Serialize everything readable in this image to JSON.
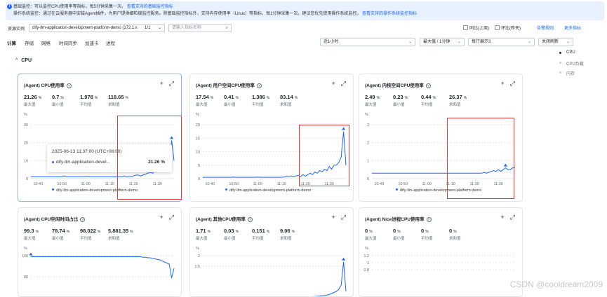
{
  "notice": {
    "line1_prefix": "基础监控：可以监控CPU使用率等指标，每5分钟采集一次。",
    "line1_link": "查看支持的基础监控指标",
    "line2_prefix": "操作系统监控：通过在云服务器中安装Agent插件，为用户提供细粒度监控服务。除基础监控指标外，支持内存使用率（Linux）等指标，每1分钟采集一次。建议您优先使用操作系统监控。",
    "line2_link": "查看支持的操作系统监控指标"
  },
  "filter": {
    "resource_label": "资源实例",
    "instance_value": "dify-llm-application-development-platform-demo (172.1...",
    "clear_icon": "×",
    "page_indicator": "1/1",
    "search_placeholder": "请输入指标名称",
    "compare_prev": "同比(上周)",
    "compare_yesterday": "环比(昨天)",
    "alarm_link": "告警规则",
    "more_link": "更多指标"
  },
  "tabs": [
    "计算",
    "存储",
    "网络",
    "时间同步",
    "加速卡",
    "进程"
  ],
  "controls": {
    "time_range": "近1小时",
    "aggregation": "最大值 / 1分钟",
    "layout": "每行展示3",
    "refresh": "关闭刷新"
  },
  "section": {
    "title": "CPU"
  },
  "sidenav": [
    "CPU",
    "CPU负载",
    "内存"
  ],
  "cards": [
    {
      "title": "(Agent) CPU使用率",
      "stats": [
        {
          "value": "21.26",
          "unit": "%",
          "name": "最大值"
        },
        {
          "value": "0.7",
          "unit": "%",
          "name": "最小值"
        },
        {
          "value": "1.978",
          "unit": "%",
          "name": "平均值"
        },
        {
          "value": "118.65",
          "unit": "%",
          "name": "求和值"
        }
      ],
      "unit": "%",
      "legend": "dify-llm-application-development-platform-demo"
    },
    {
      "title": "(Agent) 用户空间CPU使用率",
      "stats": [
        {
          "value": "17.54",
          "unit": "%",
          "name": "最大值"
        },
        {
          "value": "0.41",
          "unit": "%",
          "name": "最小值"
        },
        {
          "value": "1.386",
          "unit": "%",
          "name": "平均值"
        },
        {
          "value": "83.14",
          "unit": "%",
          "name": "求和值"
        }
      ],
      "unit": "%",
      "legend": "dify-llm-application-development-platform-demo"
    },
    {
      "title": "(Agent) 内核空间CPU使用率",
      "stats": [
        {
          "value": "2.49",
          "unit": "%",
          "name": "最大值"
        },
        {
          "value": "0.23",
          "unit": "%",
          "name": "最小值"
        },
        {
          "value": "0.44",
          "unit": "%",
          "name": "平均值"
        },
        {
          "value": "26.37",
          "unit": "%",
          "name": "求和值"
        }
      ],
      "unit": "%",
      "legend": "dify-llm-application-development-platform-demo"
    },
    {
      "title": "(Agent) CPU空闲时间占比",
      "stats": [
        {
          "value": "99.3",
          "unit": "%",
          "name": "最大值"
        },
        {
          "value": "78.74",
          "unit": "%",
          "name": "最小值"
        },
        {
          "value": "98.022",
          "unit": "%",
          "name": "平均值"
        },
        {
          "value": "5,881.35",
          "unit": "%",
          "name": "求和值"
        }
      ],
      "unit": "%",
      "legend": ""
    },
    {
      "title": "(Agent) 其他CPU使用率",
      "stats": [
        {
          "value": "1.71",
          "unit": "%",
          "name": "最大值"
        },
        {
          "value": "0.03",
          "unit": "%",
          "name": "最小值"
        },
        {
          "value": "0.151",
          "unit": "%",
          "name": "平均值"
        },
        {
          "value": "9.06",
          "unit": "%",
          "name": "求和值"
        }
      ],
      "unit": "%",
      "legend": ""
    },
    {
      "title": "(Agent) Nice进程CPU使用率",
      "stats": [
        {
          "value": "0",
          "unit": "%",
          "name": "最大值"
        },
        {
          "value": "0",
          "unit": "%",
          "name": "最小值"
        },
        {
          "value": "0",
          "unit": "%",
          "name": "平均值"
        },
        {
          "value": "0",
          "unit": "%",
          "name": "求和值"
        }
      ],
      "unit": "%",
      "legend": ""
    }
  ],
  "tooltip": {
    "time": "2025-06-13 11:37:00 (UTC+08:00)",
    "series": "dify-llm-application-devel...",
    "value": "21.26 %"
  },
  "watermark": "CSDN @cooldream2009",
  "chart_data": [
    {
      "type": "line",
      "x": [
        "10:37",
        "10:38",
        "10:39",
        "10:40",
        "10:41",
        "10:42",
        "10:43",
        "10:44",
        "10:45",
        "10:46",
        "10:47",
        "10:48",
        "10:49",
        "10:50",
        "10:51",
        "10:52",
        "10:53",
        "10:54",
        "10:55",
        "10:56",
        "10:57",
        "10:58",
        "10:59",
        "11:00",
        "11:01",
        "11:02",
        "11:03",
        "11:04",
        "11:05",
        "11:06",
        "11:07",
        "11:08",
        "11:09",
        "11:10",
        "11:11",
        "11:12",
        "11:13",
        "11:14",
        "11:15",
        "11:16",
        "11:17",
        "11:18",
        "11:19",
        "11:20",
        "11:21",
        "11:22",
        "11:23",
        "11:24",
        "11:25",
        "11:26",
        "11:27",
        "11:28",
        "11:29",
        "11:30",
        "11:31",
        "11:32",
        "11:33",
        "11:34",
        "11:35",
        "11:36",
        "11:37"
      ],
      "y_ticks": [
        0,
        10,
        20,
        30
      ],
      "x_ticks": [
        "10:40",
        "10:50",
        "11:00",
        "11:10",
        "11:20",
        "11:30"
      ],
      "series": [
        {
          "name": "dify-llm-application-development-platform-demo",
          "values": [
            1,
            1,
            1,
            1,
            1,
            1,
            1,
            1,
            1,
            1,
            1,
            1,
            1,
            1,
            1.5,
            1,
            1,
            1,
            1,
            1,
            1,
            1,
            1,
            1,
            1.2,
            1,
            1,
            1,
            1,
            1,
            1,
            1,
            1,
            1,
            1,
            1,
            1,
            1,
            1,
            1.5,
            1,
            1,
            1,
            1.5,
            2,
            2,
            1.5,
            2,
            2.5,
            3,
            3.5,
            3,
            4,
            4.5,
            5,
            6,
            8,
            7,
            9,
            21.26,
            10
          ]
        }
      ],
      "ylim": [
        0,
        30
      ]
    },
    {
      "type": "line",
      "x": [
        "10:37",
        "10:38",
        "10:39",
        "10:40",
        "10:41",
        "10:42",
        "10:43",
        "10:44",
        "10:45",
        "10:46",
        "10:47",
        "10:48",
        "10:49",
        "10:50",
        "10:51",
        "10:52",
        "10:53",
        "10:54",
        "10:55",
        "10:56",
        "10:57",
        "10:58",
        "10:59",
        "11:00",
        "11:01",
        "11:02",
        "11:03",
        "11:04",
        "11:05",
        "11:06",
        "11:07",
        "11:08",
        "11:09",
        "11:10",
        "11:11",
        "11:12",
        "11:13",
        "11:14",
        "11:15",
        "11:16",
        "11:17",
        "11:18",
        "11:19",
        "11:20",
        "11:21",
        "11:22",
        "11:23",
        "11:24",
        "11:25",
        "11:26",
        "11:27",
        "11:28",
        "11:29",
        "11:30",
        "11:31",
        "11:32",
        "11:33",
        "11:34",
        "11:35",
        "11:36",
        "11:37"
      ],
      "y_ticks": [
        0,
        5,
        10,
        15,
        20
      ],
      "x_ticks": [
        "10:40",
        "10:50",
        "11:00",
        "11:10",
        "11:20",
        "11:30"
      ],
      "series": [
        {
          "name": "dify-llm-application-development-platform-demo",
          "values": [
            0.5,
            0.5,
            0.5,
            0.5,
            0.5,
            0.5,
            0.5,
            0.5,
            0.5,
            0.5,
            0.5,
            0.5,
            0.5,
            0.6,
            0.5,
            0.5,
            0.5,
            0.5,
            0.5,
            0.5,
            0.5,
            0.5,
            0.5,
            0.6,
            0.5,
            0.5,
            0.5,
            0.5,
            0.5,
            0.5,
            0.5,
            0.5,
            0.5,
            0.5,
            0.6,
            0.8,
            0.7,
            1,
            0.8,
            1,
            1.2,
            0.8,
            1.5,
            0.9,
            1.5,
            2,
            1.5,
            2.5,
            2,
            3,
            2.5,
            3.5,
            3,
            4.5,
            3.5,
            5,
            5,
            6,
            8,
            17.54,
            5
          ]
        }
      ],
      "ylim": [
        0,
        20
      ]
    },
    {
      "type": "line",
      "x": [
        "10:37",
        "10:38",
        "10:39",
        "10:40",
        "10:41",
        "10:42",
        "10:43",
        "10:44",
        "10:45",
        "10:46",
        "10:47",
        "10:48",
        "10:49",
        "10:50",
        "10:51",
        "10:52",
        "10:53",
        "10:54",
        "10:55",
        "10:56",
        "10:57",
        "10:58",
        "10:59",
        "11:00",
        "11:01",
        "11:02",
        "11:03",
        "11:04",
        "11:05",
        "11:06",
        "11:07",
        "11:08",
        "11:09",
        "11:10",
        "11:11",
        "11:12",
        "11:13",
        "11:14",
        "11:15",
        "11:16",
        "11:17",
        "11:18",
        "11:19",
        "11:20",
        "11:21",
        "11:22",
        "11:23",
        "11:24",
        "11:25",
        "11:26",
        "11:27",
        "11:28",
        "11:29",
        "11:30",
        "11:31",
        "11:32",
        "11:33",
        "11:34",
        "11:35",
        "11:36",
        "11:37"
      ],
      "y_ticks": [
        0,
        1,
        2,
        3
      ],
      "x_ticks": [
        "10:40",
        "10:50",
        "11:00",
        "11:10",
        "11:20",
        "11:30"
      ],
      "series": [
        {
          "name": "dify-llm-application-development-platform-demo",
          "values": [
            0.3,
            0.3,
            0.3,
            0.3,
            0.3,
            0.3,
            0.3,
            0.3,
            0.3,
            0.3,
            0.3,
            0.3,
            0.3,
            0.3,
            0.3,
            0.3,
            0.3,
            0.3,
            0.3,
            0.3,
            0.3,
            0.3,
            0.3,
            0.3,
            0.3,
            0.3,
            0.3,
            0.3,
            0.3,
            0.3,
            0.3,
            0.3,
            0.3,
            0.3,
            0.3,
            0.3,
            0.3,
            0.3,
            0.3,
            0.3,
            0.3,
            0.3,
            0.3,
            0.3,
            0.3,
            0.3,
            0.3,
            0.35,
            0.3,
            0.35,
            0.4,
            0.45,
            0.4,
            0.5,
            0.4,
            0.5,
            0.6,
            0.5,
            0.5,
            0.6,
            0.6
          ]
        }
      ],
      "ylim": [
        0,
        3
      ]
    },
    {
      "type": "line",
      "x": [
        "10:37",
        "10:38",
        "10:39",
        "10:40",
        "10:41",
        "10:42",
        "10:43",
        "10:44",
        "10:45",
        "10:46",
        "10:47",
        "10:48",
        "10:49",
        "10:50",
        "10:51",
        "10:52",
        "10:53",
        "10:54",
        "10:55",
        "10:56",
        "10:57",
        "10:58",
        "10:59",
        "11:00",
        "11:01",
        "11:02",
        "11:03",
        "11:04",
        "11:05",
        "11:06",
        "11:07",
        "11:08",
        "11:09",
        "11:10",
        "11:11",
        "11:12",
        "11:13",
        "11:14",
        "11:15",
        "11:16",
        "11:17",
        "11:18",
        "11:19",
        "11:20",
        "11:21",
        "11:22",
        "11:23",
        "11:24",
        "11:25",
        "11:26",
        "11:27",
        "11:28",
        "11:29",
        "11:30",
        "11:31",
        "11:32",
        "11:33",
        "11:34",
        "11:35",
        "11:36",
        "11:37"
      ],
      "y_ticks": [
        80,
        100
      ],
      "series": [
        {
          "name": "dify-llm-application-development-platform-demo",
          "values": [
            99,
            99,
            99,
            99,
            99,
            99,
            99,
            99,
            99,
            99,
            99,
            99,
            99,
            99,
            99,
            99,
            99,
            99,
            99,
            99,
            99,
            99,
            99,
            99,
            99,
            99,
            99,
            99,
            99,
            99,
            99,
            99,
            99,
            99,
            99,
            99,
            99,
            99,
            99,
            99,
            99,
            99,
            99,
            99,
            99,
            99,
            99,
            98.5,
            98.5,
            98,
            98,
            97.5,
            97,
            96.5,
            96,
            95,
            94,
            93,
            92,
            78.74,
            88
          ]
        }
      ],
      "ylim": [
        60,
        100
      ]
    },
    {
      "type": "line",
      "x": [
        "10:37",
        "10:38",
        "10:39",
        "10:40",
        "10:41",
        "10:42",
        "10:43",
        "10:44",
        "10:45",
        "10:46",
        "10:47",
        "10:48",
        "10:49",
        "10:50",
        "10:51",
        "10:52",
        "10:53",
        "10:54",
        "10:55",
        "10:56",
        "10:57",
        "10:58",
        "10:59",
        "11:00",
        "11:01",
        "11:02",
        "11:03",
        "11:04",
        "11:05",
        "11:06",
        "11:07",
        "11:08",
        "11:09",
        "11:10",
        "11:11",
        "11:12",
        "11:13",
        "11:14",
        "11:15",
        "11:16",
        "11:17",
        "11:18",
        "11:19",
        "11:20",
        "11:21",
        "11:22",
        "11:23",
        "11:24",
        "11:25",
        "11:26",
        "11:27",
        "11:28",
        "11:29",
        "11:30",
        "11:31",
        "11:32",
        "11:33",
        "11:34",
        "11:35",
        "11:36",
        "11:37"
      ],
      "y_ticks": [
        1.5,
        2
      ],
      "series": [
        {
          "name": "dify-llm-application-development-platform-demo",
          "values": [
            0.05,
            0.05,
            0.05,
            0.05,
            0.05,
            0.05,
            0.05,
            0.05,
            0.05,
            0.05,
            0.05,
            0.05,
            0.05,
            0.05,
            0.05,
            0.05,
            0.05,
            0.05,
            0.05,
            0.05,
            0.05,
            0.05,
            0.05,
            0.05,
            0.05,
            0.05,
            0.05,
            0.05,
            0.05,
            0.05,
            0.05,
            0.05,
            0.05,
            0.05,
            0.05,
            0.05,
            0.05,
            0.05,
            0.05,
            0.05,
            0.05,
            0.05,
            0.05,
            0.05,
            0.05,
            0.05,
            0.05,
            0.06,
            0.07,
            0.08,
            0.1,
            0.1,
            0.12,
            0.15,
            0.2,
            0.25,
            0.3,
            0.4,
            0.6,
            1.71,
            0.3
          ]
        }
      ],
      "ylim": [
        0,
        2
      ]
    },
    {
      "type": "line",
      "x": [
        "10:37",
        "11:37"
      ],
      "y_ticks": [
        0.8,
        1,
        1.2
      ],
      "series": [
        {
          "name": "dify-llm-application-development-platform-demo",
          "values": [
            0,
            0
          ]
        }
      ],
      "ylim": [
        0,
        1.2
      ]
    }
  ]
}
